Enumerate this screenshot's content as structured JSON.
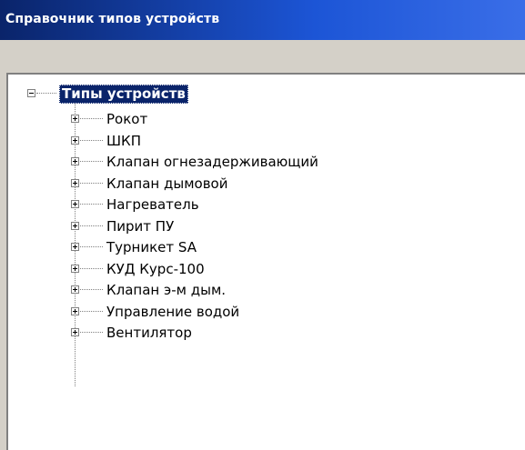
{
  "window": {
    "title": "Справочник типов устройств"
  },
  "tree": {
    "root": {
      "label": "Типы устройств",
      "expanded": true,
      "selected": true
    },
    "children": [
      {
        "label": "Рокот"
      },
      {
        "label": "ШКП"
      },
      {
        "label": "Клапан огнезадерживающий"
      },
      {
        "label": "Клапан дымовой"
      },
      {
        "label": "Нагреватель"
      },
      {
        "label": "Пирит ПУ"
      },
      {
        "label": "Турникет SA"
      },
      {
        "label": "КУД Курс-100"
      },
      {
        "label": "Клапан э-м дым."
      },
      {
        "label": "Управление водой"
      },
      {
        "label": "Вентилятор"
      }
    ]
  },
  "colors": {
    "selection": "#0a246a",
    "titlebar": "#0a246a",
    "panel": "#d4d0c8"
  }
}
